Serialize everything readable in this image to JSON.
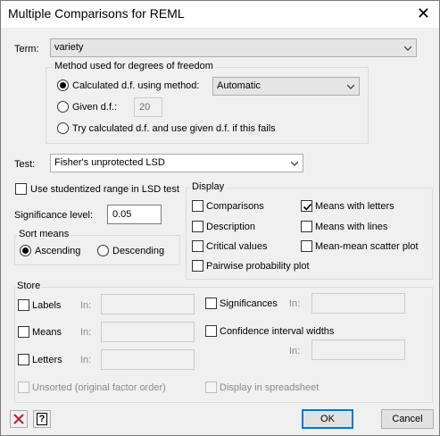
{
  "window": {
    "title": "Multiple Comparisons for REML",
    "close_glyph": "✕"
  },
  "term": {
    "label": "Term:",
    "value": "variety"
  },
  "dof": {
    "group_title": "Method used for degrees of freedom",
    "calculated_label": "Calculated d.f. using method:",
    "method_value": "Automatic",
    "given_label": "Given d.f.:",
    "given_value": "20",
    "try_label": "Try calculated d.f. and use given d.f. if this fails",
    "selected": "calculated"
  },
  "test": {
    "label": "Test:",
    "value": "Fisher's unprotected LSD"
  },
  "studentized": {
    "label": "Use studentized range in LSD test",
    "checked": false
  },
  "significance": {
    "label": "Significance level:",
    "value": "0.05"
  },
  "sort_means": {
    "group_title": "Sort means",
    "ascending_label": "Ascending",
    "descending_label": "Descending",
    "selected": "ascending"
  },
  "display": {
    "group_title": "Display",
    "comparisons": {
      "label": "Comparisons",
      "checked": false
    },
    "description": {
      "label": "Description",
      "checked": false
    },
    "critical_values": {
      "label": "Critical values",
      "checked": false
    },
    "pairwise_probability_plot": {
      "label": "Pairwise probability plot",
      "checked": false
    },
    "means_with_letters": {
      "label": "Means with letters",
      "checked": true
    },
    "means_with_lines": {
      "label": "Means with lines",
      "checked": false
    },
    "mean_mean_scatter_plot": {
      "label": "Mean-mean scatter plot",
      "checked": false
    }
  },
  "store": {
    "group_title": "Store",
    "in_label": "In:",
    "labels": {
      "label": "Labels",
      "value": ""
    },
    "means": {
      "label": "Means",
      "value": ""
    },
    "letters": {
      "label": "Letters",
      "value": ""
    },
    "significances": {
      "label": "Significances",
      "value": ""
    },
    "confidence_interval_widths": {
      "label": "Confidence interval widths",
      "value": ""
    },
    "unsorted_label": "Unsorted (original factor order)",
    "display_in_spreadsheet_label": "Display in spreadsheet"
  },
  "buttons": {
    "ok": "OK",
    "cancel": "Cancel",
    "help_glyph": "?"
  }
}
